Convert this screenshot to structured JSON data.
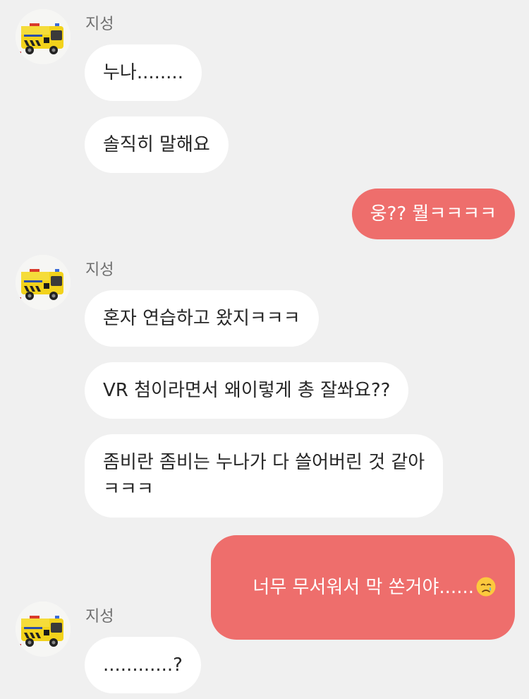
{
  "sender_name": "지성",
  "avatar": {
    "icon": "ambulance-icon",
    "alt": "yellow ambulance toy avatar"
  },
  "messages_group1": [
    "누나........",
    "솔직히 말해요"
  ],
  "outgoing1": "웅?? 뭘ㅋㅋㅋㅋ",
  "messages_group2": [
    "혼자 연습하고 왔지ㅋㅋㅋ",
    "VR 첨이라면서 왜이렇게 총 잘쏴요??",
    "좀비란 좀비는 누나가 다 쓸어버린 것 같아\nㅋㅋㅋ"
  ],
  "outgoing2": {
    "text": "너무 무서워서 막 쏜거야......",
    "emoji": "crying-face-icon"
  },
  "messages_group3": [
    "............?"
  ],
  "colors": {
    "background": "#f0f0f0",
    "incoming_bubble": "#ffffff",
    "outgoing_bubble": "#ee6e6c",
    "text": "#262626",
    "sender": "#6e6e6e"
  }
}
